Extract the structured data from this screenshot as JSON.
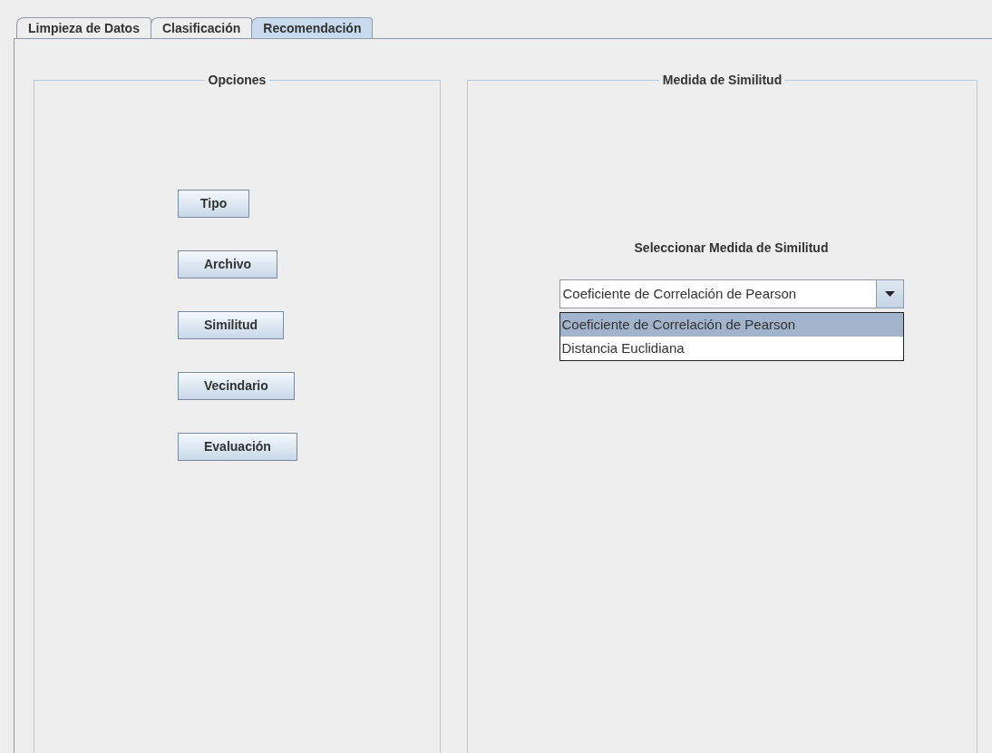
{
  "tabs": [
    {
      "label": "Limpieza de Datos",
      "selected": false
    },
    {
      "label": "Clasificación",
      "selected": false
    },
    {
      "label": "Recomendación",
      "selected": true
    }
  ],
  "options_panel": {
    "title": "Opciones",
    "buttons": [
      "Tipo",
      "Archivo",
      "Similitud",
      "Vecindario",
      "Evaluación"
    ]
  },
  "similarity_panel": {
    "title": "Medida de Similitud",
    "label": "Seleccionar Medida de Similitud",
    "combo": {
      "value": "Coeficiente de Correlación de Pearson",
      "expanded": true,
      "options": [
        {
          "label": "Coeficiente de Correlación de Pearson",
          "selected": true
        },
        {
          "label": "Distancia Euclidiana",
          "selected": false
        }
      ]
    }
  }
}
